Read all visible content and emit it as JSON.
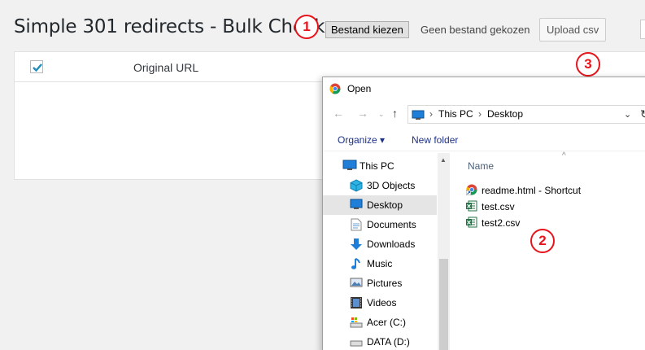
{
  "page": {
    "title": "Simple 301 redirects - Bulk Check.",
    "file_button": "Bestand kiezen",
    "file_status": "Geen bestand gekozen",
    "upload_button": "Upload csv",
    "badges": [
      "1",
      "2",
      "3"
    ]
  },
  "table": {
    "header_checkbox_checked": true,
    "column_original_url": "Original URL"
  },
  "dialog": {
    "title": "Open",
    "address": {
      "crumbs": [
        "This PC",
        "Desktop"
      ],
      "separator": "›"
    },
    "commands": {
      "organize": "Organize ▾",
      "new_folder": "New folder"
    },
    "nav_items": [
      {
        "label": "This PC",
        "icon": "pc-icon"
      },
      {
        "label": "3D Objects",
        "icon": "cube-icon"
      },
      {
        "label": "Desktop",
        "icon": "desktop-icon"
      },
      {
        "label": "Documents",
        "icon": "document-icon"
      },
      {
        "label": "Downloads",
        "icon": "download-icon"
      },
      {
        "label": "Music",
        "icon": "music-icon"
      },
      {
        "label": "Pictures",
        "icon": "pictures-icon"
      },
      {
        "label": "Videos",
        "icon": "videos-icon"
      },
      {
        "label": "Acer (C:)",
        "icon": "drive-icon"
      },
      {
        "label": "DATA (D:)",
        "icon": "drive-icon"
      }
    ],
    "file_column": "Name",
    "files": [
      {
        "name": "readme.html - Shortcut",
        "icon": "chrome-shortcut-icon"
      },
      {
        "name": "test.csv",
        "icon": "excel-csv-icon"
      },
      {
        "name": "test2.csv",
        "icon": "excel-csv-icon"
      }
    ]
  },
  "colors": {
    "badge": "#e8141b",
    "selection": "#e5e5e5",
    "command_text": "#1e3287",
    "checkbox_accent": "#1e8cbe"
  }
}
